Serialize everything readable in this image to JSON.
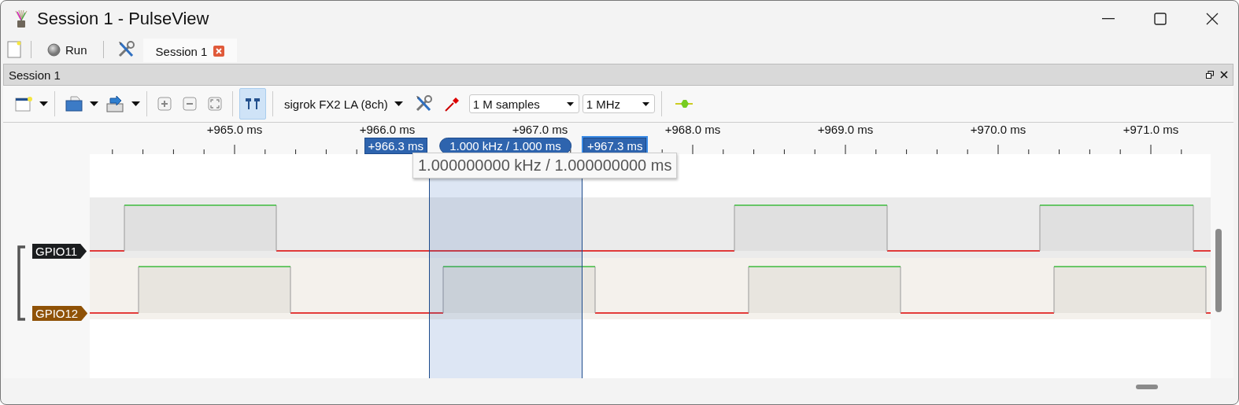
{
  "window": {
    "title": "Session 1 - PulseView"
  },
  "main_toolbar": {
    "run_label": "Run"
  },
  "tabs": [
    {
      "label": "Session 1",
      "selected": true
    }
  ],
  "dock": {
    "title": "Session 1"
  },
  "toolbar": {
    "device": "sigrok FX2 LA (8ch)",
    "samples": "1 M samples",
    "rate": "1 MHz",
    "cursors_on": true
  },
  "ruler": {
    "ticks": [
      "+965.0 ms",
      "+966.0 ms",
      "+967.0 ms",
      "+968.0 ms",
      "+969.0 ms",
      "+970.0 ms",
      "+971.0 ms"
    ]
  },
  "cursors": {
    "start": "+966.3 ms",
    "span": "1.000 kHz / 1.000 ms",
    "end": "+967.3 ms",
    "tooltip": "1.000000000 kHz / 1.000000000 ms"
  },
  "channels": [
    {
      "name": "GPIO11",
      "color": "#1b1d1f"
    },
    {
      "name": "GPIO12",
      "color": "#8f5207"
    }
  ]
}
